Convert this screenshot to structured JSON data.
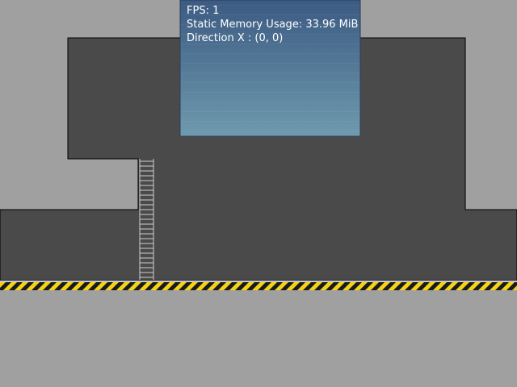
{
  "scene": {
    "colors": {
      "background": "#a0a0a0",
      "wall": "#4a4a4a",
      "wall_outline": "#000000",
      "ladder": "#cfcfcf",
      "hazard_yellow": "#f2d21a",
      "hazard_black": "#1a1a1a",
      "ground": "#a0a0a0",
      "overlay_top": "#3b5a82",
      "overlay_bottom": "#6f9aae"
    },
    "elements": [
      "wall-structure",
      "ladder",
      "hazard-stripe-floor",
      "debug-overlay-panel"
    ]
  },
  "debug": {
    "fps_label": "FPS: 1",
    "memory_label": "Static Memory Usage: 33.96 MiB",
    "direction_label": "Direction X : (0, 0)"
  }
}
